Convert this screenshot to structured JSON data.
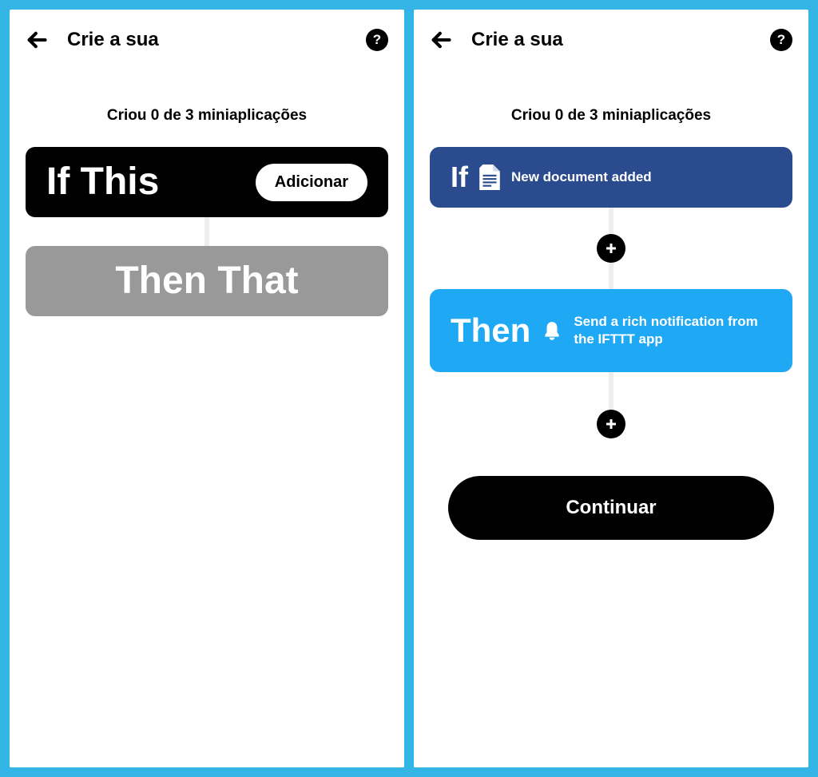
{
  "left": {
    "header": {
      "title": "Crie a sua"
    },
    "subtitle": "Criou 0 de 3 miniaplicações",
    "ifCard": {
      "title": "If This",
      "button": "Adicionar"
    },
    "thenCard": {
      "title": "Then That"
    }
  },
  "right": {
    "header": {
      "title": "Crie a sua"
    },
    "subtitle": "Criou 0 de 3 miniaplicações",
    "ifCard": {
      "title": "If",
      "desc": "New document added"
    },
    "thenCard": {
      "title": "Then",
      "desc": "Send a rich notification from the IFTTT app"
    },
    "continue": "Continuar"
  }
}
